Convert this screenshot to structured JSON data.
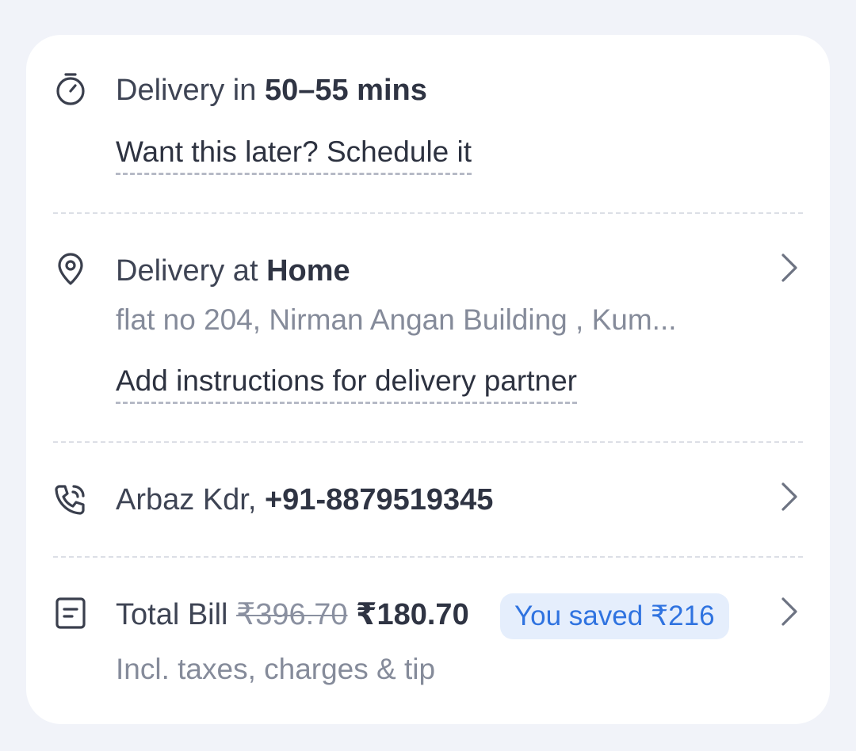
{
  "delivery_time": {
    "icon": "stopwatch-icon",
    "prefix": "Delivery in ",
    "time": "50–55 mins",
    "schedule_link": "Want this later? Schedule it"
  },
  "address": {
    "icon": "location-pin-icon",
    "prefix": "Delivery at ",
    "label": "Home",
    "address_line": "flat no 204, Nirman Angan Building , Kum...",
    "instructions_link": "Add instructions for delivery partner"
  },
  "contact": {
    "icon": "phone-icon",
    "name": "Arbaz Kdr, ",
    "phone": "+91-8879519345"
  },
  "bill": {
    "icon": "receipt-icon",
    "label": "Total Bill ",
    "original_price": "₹396.70",
    "final_price": "₹180.70",
    "savings_badge": "You saved ₹216",
    "note": "Incl. taxes, charges & tip"
  },
  "colors": {
    "background": "#f1f3f9",
    "card": "#ffffff",
    "text_primary": "#2f3443",
    "text_secondary": "#858b9a",
    "badge_bg": "#e5eefc",
    "badge_text": "#2f73e0"
  }
}
